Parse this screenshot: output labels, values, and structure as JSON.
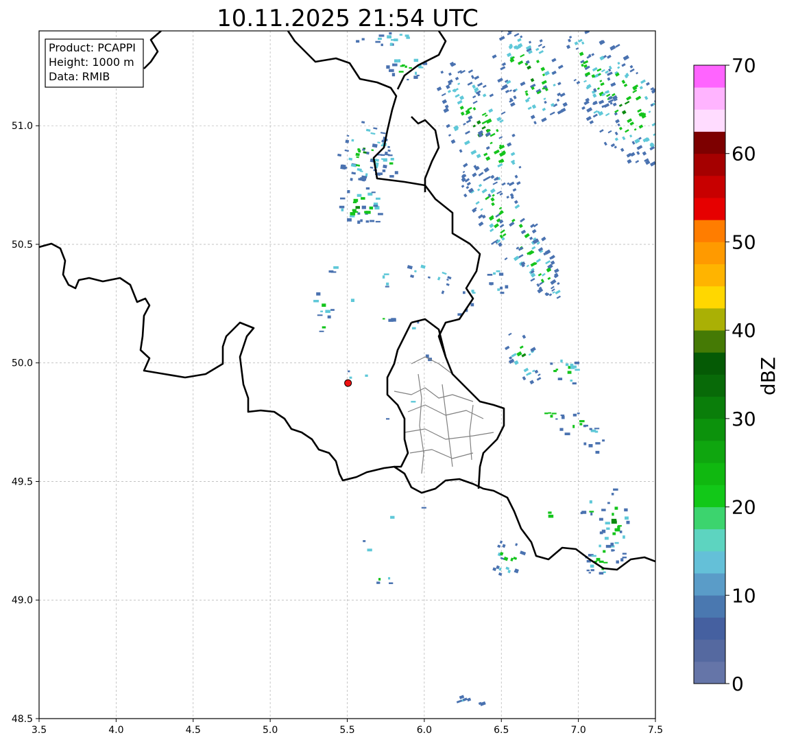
{
  "title": "10.11.2025 21:54 UTC",
  "info_box": {
    "line1": "Product: PCAPPI",
    "line2": "Height: 1000 m",
    "line3": "Data: RMIB"
  },
  "axes": {
    "x_ticks": [
      "3.5",
      "4.0",
      "4.5",
      "5.0",
      "5.5",
      "6.0",
      "6.5",
      "7.0",
      "7.5"
    ],
    "y_ticks": [
      "51.0",
      "50.5",
      "50.0",
      "49.5",
      "49.0",
      "48.5"
    ],
    "x_range": [
      3.5,
      7.5
    ],
    "y_range": [
      48.5,
      51.4
    ],
    "grid": true
  },
  "colorbar": {
    "label": "dBZ",
    "tick_labels": [
      "0",
      "10",
      "20",
      "30",
      "40",
      "50",
      "60",
      "70"
    ],
    "min": 0,
    "max": 70,
    "step": 2.5,
    "colors": [
      "#6575a8",
      "#5569a0",
      "#4560a0",
      "#4a78b0",
      "#5a9cc8",
      "#64c0d8",
      "#5dd4c0",
      "#3cd46e",
      "#12c818",
      "#10b810",
      "#0fa60f",
      "#0c920c",
      "#0a7e0a",
      "#086a08",
      "#055a05",
      "#457a05",
      "#aab005",
      "#ffd700",
      "#ffb400",
      "#ff9a00",
      "#ff7d00",
      "#e60000",
      "#c80000",
      "#a50000",
      "#7d0000",
      "#ffdcff",
      "#ffb4ff",
      "#ff64ff",
      "#ee32ee"
    ]
  },
  "radar_site": {
    "lon": 5.505,
    "lat": 49.915,
    "color": "#ee1111"
  },
  "map_colors": {
    "light_echo": "#4a72b0",
    "medium_echo": "#5fc8d8",
    "strong_echo": "#14c41c",
    "core_echo": "#0c8a10"
  }
}
